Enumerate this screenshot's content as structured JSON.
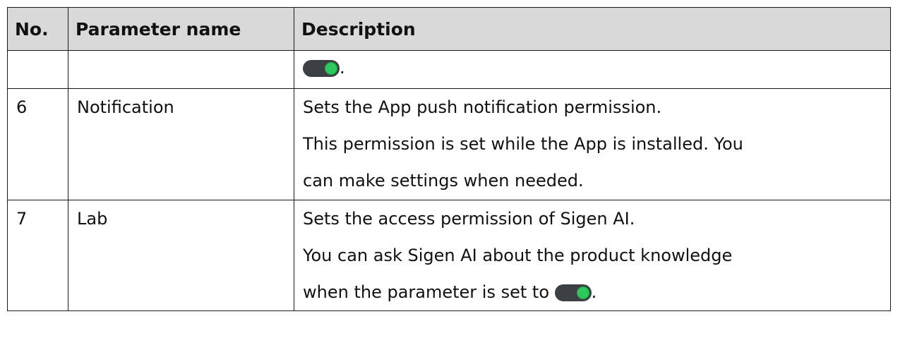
{
  "table": {
    "headers": [
      "No.",
      "Parameter name",
      "Description"
    ],
    "continuation_row": {
      "suffix": "."
    },
    "rows": [
      {
        "no": "6",
        "name": "Notification",
        "lines": [
          "Sets the App push notification permission.",
          "This permission is set while the App is installed. You",
          "can make settings when needed."
        ]
      },
      {
        "no": "7",
        "name": "Lab",
        "lines": [
          "Sets the access permission of Sigen AI.",
          "You can ask Sigen AI about the product knowledge",
          "when the parameter is set to"
        ],
        "suffix": "."
      }
    ]
  },
  "colors": {
    "header_bg": "#d9d9d9",
    "border": "#1a1a1a",
    "toggle_track": "#3d4043",
    "toggle_knob": "#2ec95c"
  },
  "icons": [
    "toggle-on-icon"
  ]
}
